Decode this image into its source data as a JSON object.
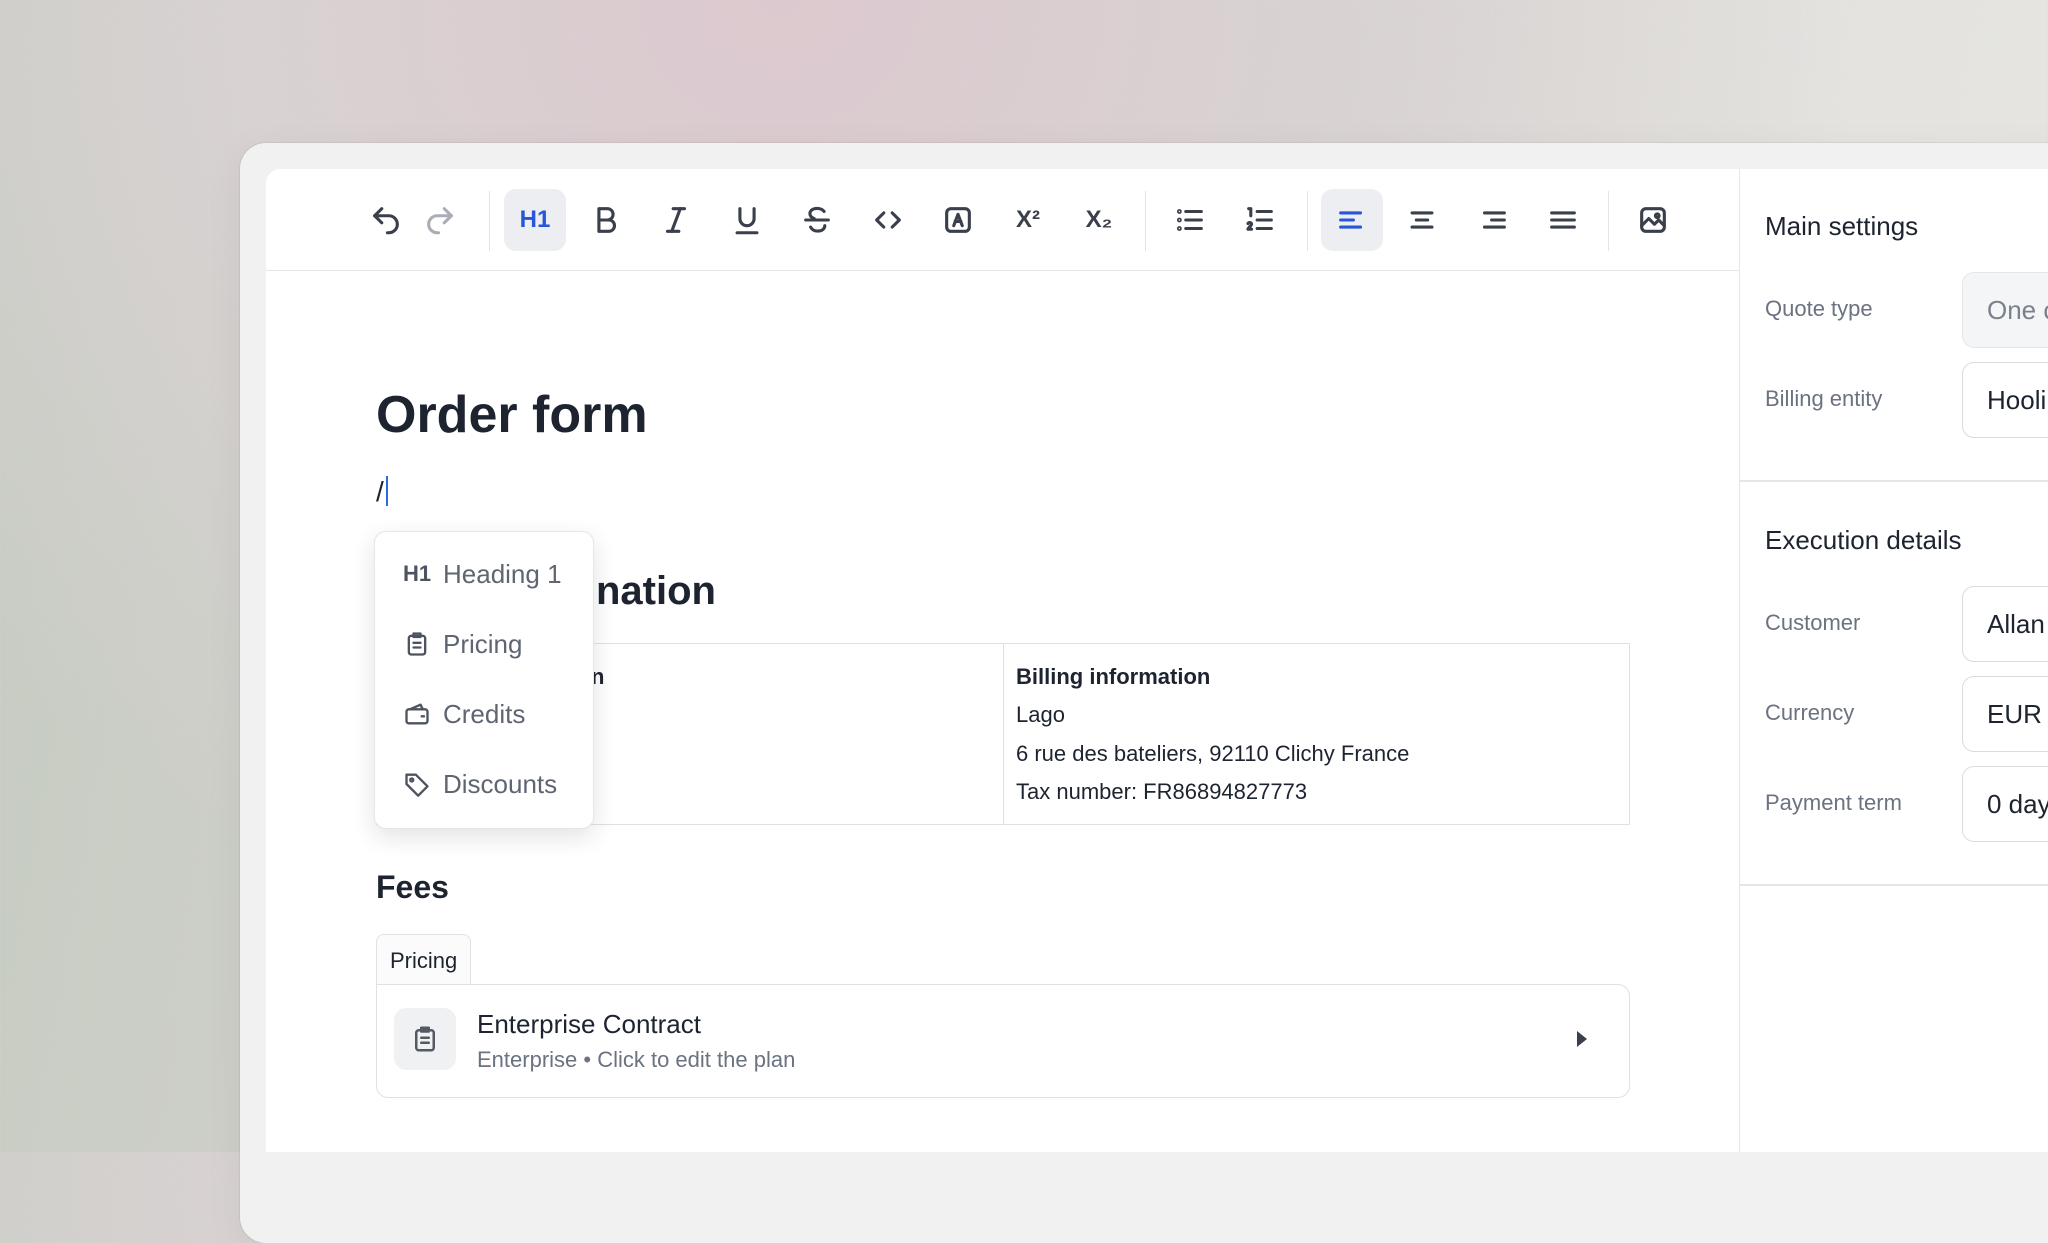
{
  "toolbar": {
    "undo": "undo-icon",
    "redo": "redo-icon",
    "heading1": "H1",
    "superscript": "X²",
    "subscript": "X₂"
  },
  "editor": {
    "title": "Order form",
    "slash_text": "/",
    "section_title_visible": "nation",
    "left_col_partial": "n",
    "billing": {
      "header": "Billing information",
      "name": "Lago",
      "address": "6  rue des bateliers, 92110 Clichy France",
      "tax": "Tax number: FR86894827773"
    },
    "fees_title": "Fees",
    "pricing_tab": "Pricing",
    "plan": {
      "name": "Enterprise Contract",
      "subtitle": "Enterprise • Click to edit the plan"
    }
  },
  "slash_menu": {
    "items": [
      {
        "label": "Heading 1",
        "icon": "H1"
      },
      {
        "label": "Pricing",
        "icon": "clipboard-icon"
      },
      {
        "label": "Credits",
        "icon": "wallet-icon"
      },
      {
        "label": "Discounts",
        "icon": "tag-icon"
      }
    ]
  },
  "settings": {
    "main_title": "Main settings",
    "quote_type_label": "Quote type",
    "quote_type_value": "One c",
    "billing_entity_label": "Billing entity",
    "billing_entity_value": "Hooli",
    "execution_title": "Execution details",
    "customer_label": "Customer",
    "customer_value": "Allan",
    "currency_label": "Currency",
    "currency_value": "EUR",
    "payment_term_label": "Payment term",
    "payment_term_value": "0 day"
  }
}
